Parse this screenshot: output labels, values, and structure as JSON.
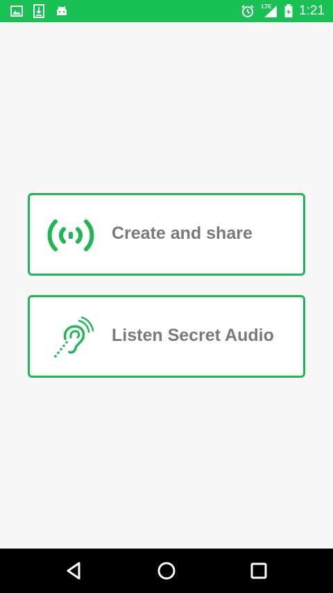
{
  "status_bar": {
    "time": "1:21",
    "network": "LTE",
    "icons": [
      "image-icon",
      "download-icon",
      "android-icon",
      "alarm-icon",
      "signal-icon",
      "battery-charging-icon"
    ]
  },
  "main": {
    "buttons": [
      {
        "label": "Create and share",
        "icon": "broadcast-icon"
      },
      {
        "label": "Listen Secret Audio",
        "icon": "hearing-icon"
      }
    ]
  },
  "nav_bar": {
    "icons": [
      "back-icon",
      "home-icon",
      "recents-icon"
    ]
  },
  "colors": {
    "accent": "#19c155",
    "border": "#1fb653",
    "label": "#7a7a7a",
    "background": "#f8f8f8"
  }
}
